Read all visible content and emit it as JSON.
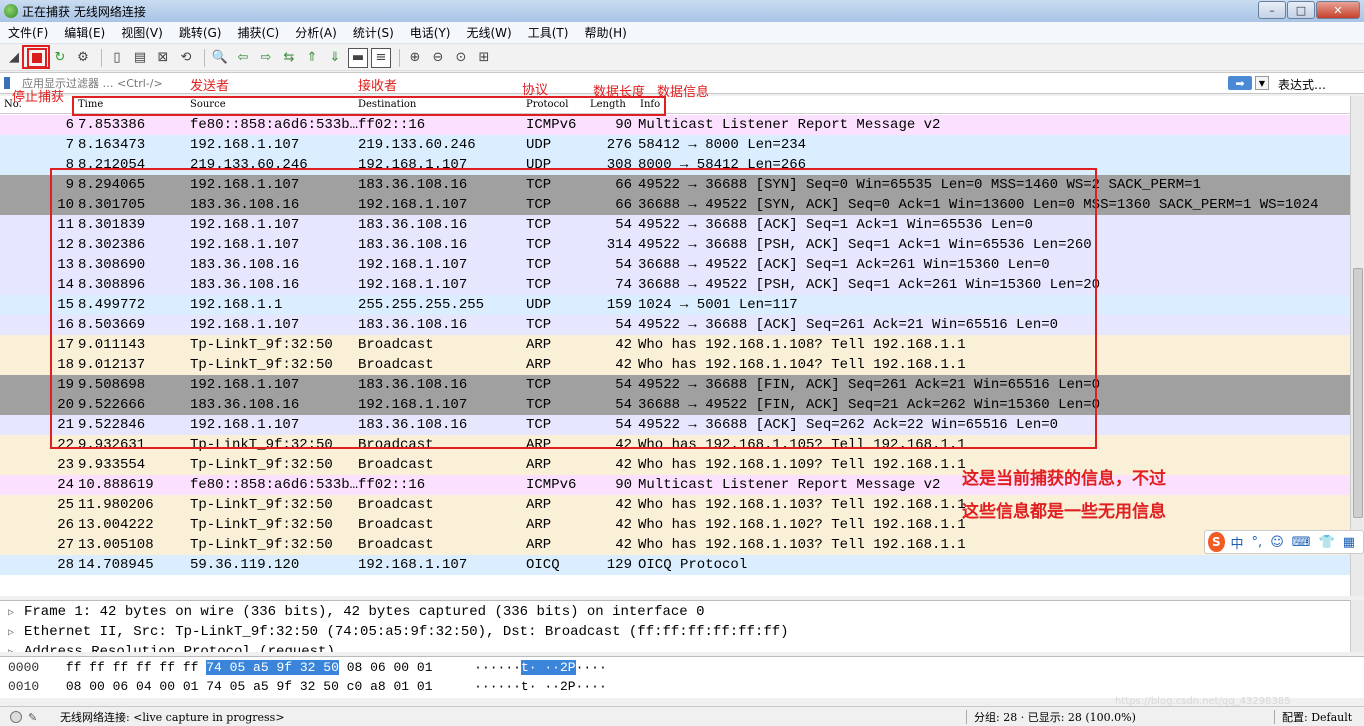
{
  "window": {
    "title": "正在捕获 无线网络连接",
    "min": "–",
    "max": "□",
    "close": "✕"
  },
  "menu": [
    "文件(F)",
    "编辑(E)",
    "视图(V)",
    "跳转(G)",
    "捕获(C)",
    "分析(A)",
    "统计(S)",
    "电话(Y)",
    "无线(W)",
    "工具(T)",
    "帮助(H)"
  ],
  "filter": {
    "placeholder": "应用显示过滤器 … <Ctrl-/>",
    "apply": "➡",
    "dropdown": "▼",
    "expression": "表达式…",
    "bookmark_icon": "bookmark-icon"
  },
  "columns": {
    "no": "No.",
    "time": "Time",
    "source": "Source",
    "destination": "Destination",
    "protocol": "Protocol",
    "length": "Length",
    "info": "Info"
  },
  "packets": [
    {
      "no": "6",
      "time": "7.853386",
      "src": "fe80::858:a6d6:533b…",
      "dst": "ff02::16",
      "proto": "ICMPv6",
      "len": "90",
      "info": "Multicast Listener Report Message v2",
      "bg": "#fce0ff"
    },
    {
      "no": "7",
      "time": "8.163473",
      "src": "192.168.1.107",
      "dst": "219.133.60.246",
      "proto": "UDP",
      "len": "276",
      "info": "58412 → 8000 Len=234",
      "bg": "#daeeff"
    },
    {
      "no": "8",
      "time": "8.212054",
      "src": "219.133.60.246",
      "dst": "192.168.1.107",
      "proto": "UDP",
      "len": "308",
      "info": "8000 → 58412 Len=266",
      "bg": "#daeeff"
    },
    {
      "no": "9",
      "time": "8.294065",
      "src": "192.168.1.107",
      "dst": "183.36.108.16",
      "proto": "TCP",
      "len": "66",
      "info": "49522 → 36688 [SYN] Seq=0 Win=65535 Len=0 MSS=1460 WS=2 SACK_PERM=1",
      "bg": "#a0a0a0"
    },
    {
      "no": "10",
      "time": "8.301705",
      "src": "183.36.108.16",
      "dst": "192.168.1.107",
      "proto": "TCP",
      "len": "66",
      "info": "36688 → 49522 [SYN, ACK] Seq=0 Ack=1 Win=13600 Len=0 MSS=1360 SACK_PERM=1 WS=1024",
      "bg": "#a0a0a0"
    },
    {
      "no": "11",
      "time": "8.301839",
      "src": "192.168.1.107",
      "dst": "183.36.108.16",
      "proto": "TCP",
      "len": "54",
      "info": "49522 → 36688 [ACK] Seq=1 Ack=1 Win=65536 Len=0",
      "bg": "#e7e6ff"
    },
    {
      "no": "12",
      "time": "8.302386",
      "src": "192.168.1.107",
      "dst": "183.36.108.16",
      "proto": "TCP",
      "len": "314",
      "info": "49522 → 36688 [PSH, ACK] Seq=1 Ack=1 Win=65536 Len=260",
      "bg": "#e7e6ff"
    },
    {
      "no": "13",
      "time": "8.308690",
      "src": "183.36.108.16",
      "dst": "192.168.1.107",
      "proto": "TCP",
      "len": "54",
      "info": "36688 → 49522 [ACK] Seq=1 Ack=261 Win=15360 Len=0",
      "bg": "#e7e6ff"
    },
    {
      "no": "14",
      "time": "8.308896",
      "src": "183.36.108.16",
      "dst": "192.168.1.107",
      "proto": "TCP",
      "len": "74",
      "info": "36688 → 49522 [PSH, ACK] Seq=1 Ack=261 Win=15360 Len=20",
      "bg": "#e7e6ff"
    },
    {
      "no": "15",
      "time": "8.499772",
      "src": "192.168.1.1",
      "dst": "255.255.255.255",
      "proto": "UDP",
      "len": "159",
      "info": "1024 → 5001 Len=117",
      "bg": "#daeeff"
    },
    {
      "no": "16",
      "time": "8.503669",
      "src": "192.168.1.107",
      "dst": "183.36.108.16",
      "proto": "TCP",
      "len": "54",
      "info": "49522 → 36688 [ACK] Seq=261 Ack=21 Win=65516 Len=0",
      "bg": "#e7e6ff"
    },
    {
      "no": "17",
      "time": "9.011143",
      "src": "Tp-LinkT_9f:32:50",
      "dst": "Broadcast",
      "proto": "ARP",
      "len": "42",
      "info": "Who has 192.168.1.108? Tell 192.168.1.1",
      "bg": "#faf0d7"
    },
    {
      "no": "18",
      "time": "9.012137",
      "src": "Tp-LinkT_9f:32:50",
      "dst": "Broadcast",
      "proto": "ARP",
      "len": "42",
      "info": "Who has 192.168.1.104? Tell 192.168.1.1",
      "bg": "#faf0d7"
    },
    {
      "no": "19",
      "time": "9.508698",
      "src": "192.168.1.107",
      "dst": "183.36.108.16",
      "proto": "TCP",
      "len": "54",
      "info": "49522 → 36688 [FIN, ACK] Seq=261 Ack=21 Win=65516 Len=0",
      "bg": "#a0a0a0"
    },
    {
      "no": "20",
      "time": "9.522666",
      "src": "183.36.108.16",
      "dst": "192.168.1.107",
      "proto": "TCP",
      "len": "54",
      "info": "36688 → 49522 [FIN, ACK] Seq=21 Ack=262 Win=15360 Len=0",
      "bg": "#a0a0a0"
    },
    {
      "no": "21",
      "time": "9.522846",
      "src": "192.168.1.107",
      "dst": "183.36.108.16",
      "proto": "TCP",
      "len": "54",
      "info": "49522 → 36688 [ACK] Seq=262 Ack=22 Win=65516 Len=0",
      "bg": "#e7e6ff"
    },
    {
      "no": "22",
      "time": "9.932631",
      "src": "Tp-LinkT_9f:32:50",
      "dst": "Broadcast",
      "proto": "ARP",
      "len": "42",
      "info": "Who has 192.168.1.105? Tell 192.168.1.1",
      "bg": "#faf0d7"
    },
    {
      "no": "23",
      "time": "9.933554",
      "src": "Tp-LinkT_9f:32:50",
      "dst": "Broadcast",
      "proto": "ARP",
      "len": "42",
      "info": "Who has 192.168.1.109? Tell 192.168.1.1",
      "bg": "#faf0d7"
    },
    {
      "no": "24",
      "time": "10.888619",
      "src": "fe80::858:a6d6:533b…",
      "dst": "ff02::16",
      "proto": "ICMPv6",
      "len": "90",
      "info": "Multicast Listener Report Message v2",
      "bg": "#fce0ff"
    },
    {
      "no": "25",
      "time": "11.980206",
      "src": "Tp-LinkT_9f:32:50",
      "dst": "Broadcast",
      "proto": "ARP",
      "len": "42",
      "info": "Who has 192.168.1.103? Tell 192.168.1.1",
      "bg": "#faf0d7"
    },
    {
      "no": "26",
      "time": "13.004222",
      "src": "Tp-LinkT_9f:32:50",
      "dst": "Broadcast",
      "proto": "ARP",
      "len": "42",
      "info": "Who has 192.168.1.102? Tell 192.168.1.1",
      "bg": "#faf0d7"
    },
    {
      "no": "27",
      "time": "13.005108",
      "src": "Tp-LinkT_9f:32:50",
      "dst": "Broadcast",
      "proto": "ARP",
      "len": "42",
      "info": "Who has 192.168.1.103? Tell 192.168.1.1",
      "bg": "#faf0d7"
    },
    {
      "no": "28",
      "time": "14.708945",
      "src": "59.36.119.120",
      "dst": "192.168.1.107",
      "proto": "OICQ",
      "len": "129",
      "info": "OICQ Protocol",
      "bg": "#daeeff"
    }
  ],
  "details": [
    "Frame 1: 42 bytes on wire (336 bits), 42 bytes captured (336 bits) on interface 0",
    "Ethernet II, Src: Tp-LinkT_9f:32:50 (74:05:a5:9f:32:50), Dst: Broadcast (ff:ff:ff:ff:ff:ff)",
    "Address Resolution Protocol (request)"
  ],
  "bytes": [
    {
      "offset": "0000",
      "hex_a": "ff ff ff ff ff ff",
      "hex_hl": "74 05  a5 9f 32 50",
      "hex_b": "08 06 00 01",
      "ascii_a": "······",
      "ascii_hl": "t· ··2P",
      "ascii_b": "····"
    },
    {
      "offset": "0010",
      "hex_a": "08 00 06 04 00 01 74 05",
      "hex_hl": "",
      "hex_b": "a5 9f 32 50 c0 a8 01 01",
      "ascii_a": "······t·",
      "ascii_hl": "",
      "ascii_b": " ··2P····"
    }
  ],
  "status": {
    "capture": "无线网络连接: <live capture in progress>",
    "counts": "分组: 28 · 已显示: 28 (100.0%)",
    "profile": "配置: Default"
  },
  "annotations": {
    "stop": "停止捕获",
    "source": "发送者",
    "destination": "接收者",
    "protocol": "协议",
    "length": "数据长度",
    "info": "数据信息",
    "note_line1": "这是当前捕获的信息，不过",
    "note_line2": "这些信息都是一些无用信息"
  },
  "ime": {
    "logo": "S",
    "mode": "中",
    "punct": "°,",
    "emoji": "☺",
    "keyboard": "⌨",
    "skin": "👕",
    "tools": "▦"
  },
  "watermark": "https://blog.csdn.net/qq_43298385",
  "colors": {
    "accent_red": "#e02020",
    "tcp_dark": "#a0a0a0",
    "tcp": "#e7e6ff",
    "udp": "#daeeff",
    "arp": "#faf0d7",
    "icmpv6": "#fce0ff",
    "highlight": "#3a85d9"
  }
}
